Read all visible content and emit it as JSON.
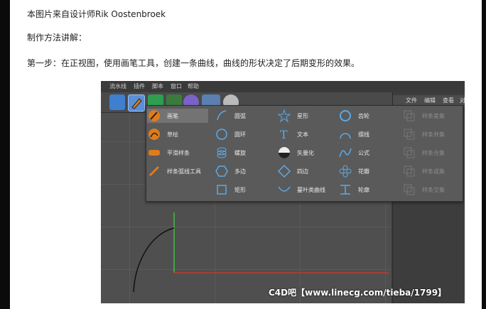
{
  "article": {
    "line1": "本图片来自设计师Rik Oostenbroek",
    "line2": "制作方法讲解：",
    "line3": "第一步：在正视图，使用画笔工具，创建一条曲线，曲线的形状决定了后期变形的效果。"
  },
  "app": {
    "menu": [
      "流水线",
      "插件",
      "脚本",
      "窗口",
      "帮助"
    ],
    "right_tabs": [
      "文件",
      "编辑",
      "查看",
      "对"
    ]
  },
  "spline_menu": {
    "col1": [
      "画笔",
      "草绘",
      "平滑样条",
      "样条弧线工具"
    ],
    "col2": [
      "圆弧",
      "圆环",
      "螺旋",
      "多边",
      "矩形"
    ],
    "col3": [
      "星形",
      "文本",
      "矢量化",
      "四边",
      "蔓叶类曲线"
    ],
    "col4": [
      "齿轮",
      "摆线",
      "公式",
      "花瓣",
      "轮廓"
    ],
    "col5": [
      "样条差集",
      "样条并集",
      "样条合集",
      "样条或集",
      "样条交集"
    ]
  },
  "watermark": "C4D吧【www.linecg.com/tieba/1799】",
  "colors": {
    "accent_orange": "#e07b1a",
    "spline_blue": "#5aa9e6",
    "axis_green": "#3fbf3f",
    "axis_red": "#c0392b"
  }
}
